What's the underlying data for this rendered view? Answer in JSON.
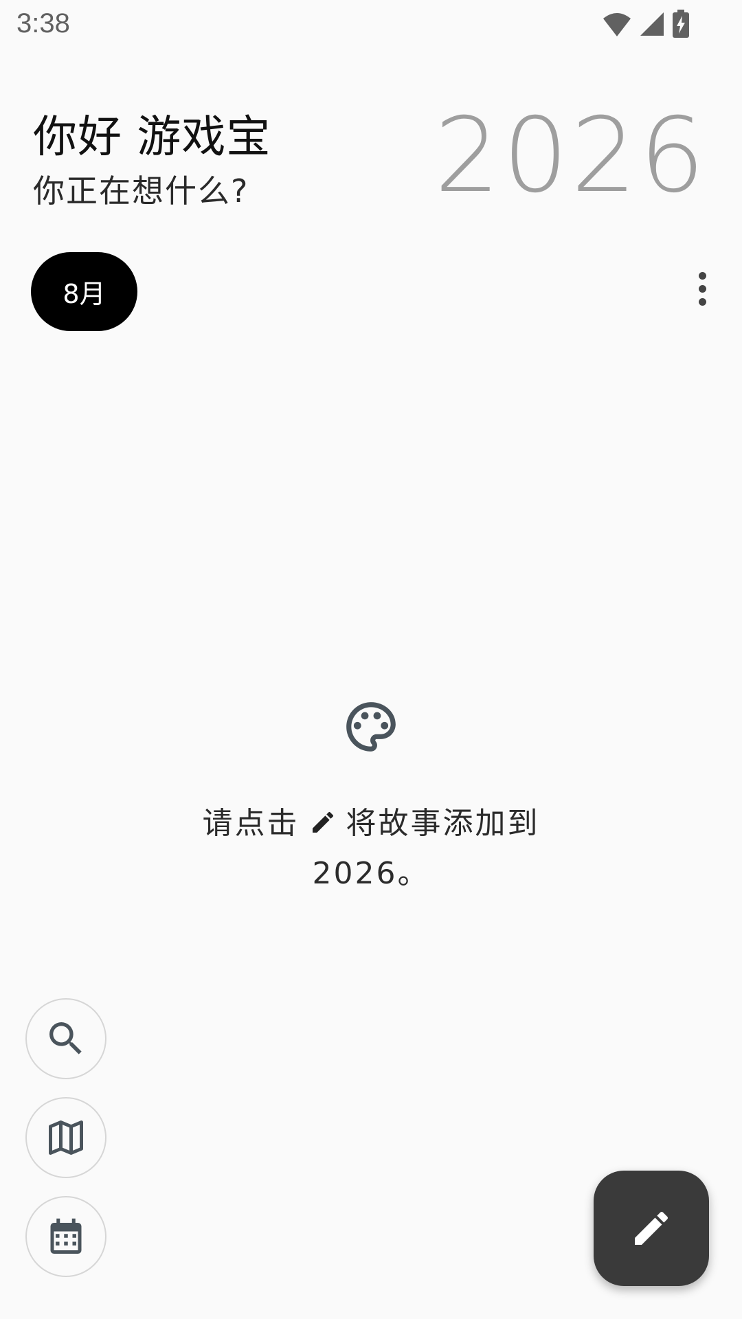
{
  "status_bar": {
    "time": "3:38",
    "icons": [
      "wifi-icon",
      "cell-signal-icon",
      "battery-charging-icon"
    ]
  },
  "header": {
    "greeting": "你好 游戏宝",
    "subtitle": "你正在想什么?",
    "year": "2026"
  },
  "filter": {
    "month_chip": "8月",
    "more_icon": "more-vert-icon"
  },
  "empty_state": {
    "icon": "palette-icon",
    "text_before": "请点击",
    "inline_icon": "pencil-icon",
    "text_after": "将故事添加到",
    "text_line2": "2026。"
  },
  "side_buttons": [
    {
      "icon": "search-icon"
    },
    {
      "icon": "map-icon"
    },
    {
      "icon": "calendar-icon"
    }
  ],
  "fab": {
    "icon": "pencil-icon"
  },
  "colors": {
    "background": "#fafafa",
    "chip_bg": "#000000",
    "year_color": "#9e9e9e",
    "fab_bg": "#3a3a3a",
    "icon_color": "#4a545c"
  }
}
